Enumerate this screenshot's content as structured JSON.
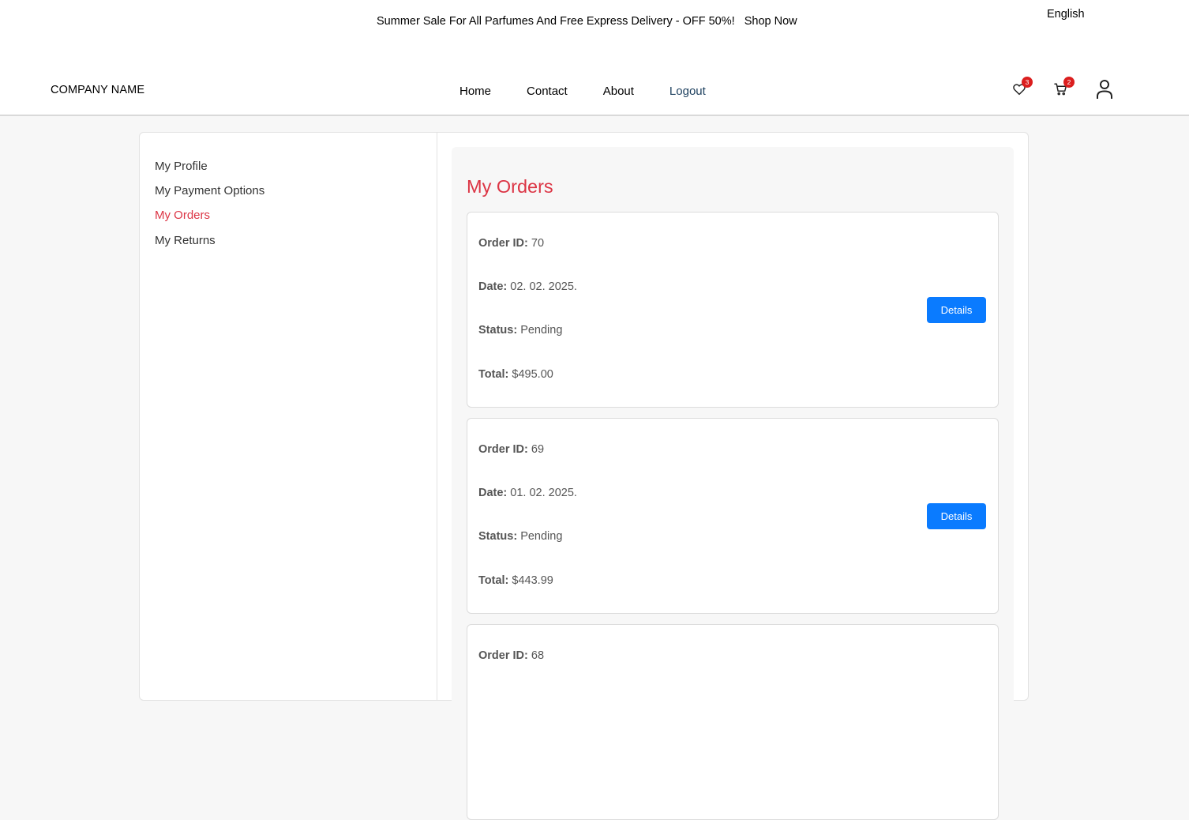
{
  "promo": {
    "text": "Summer Sale For All Parfumes And Free Express Delivery - OFF 50%!",
    "link": "Shop Now"
  },
  "language": "English",
  "brand": "COMPANY NAME",
  "nav": {
    "home": "Home",
    "contact": "Contact",
    "about": "About",
    "logout": "Logout"
  },
  "icons": {
    "wishlist": "heart-icon",
    "cart": "cart-icon",
    "user": "user-icon"
  },
  "badges": {
    "wishlist": "3",
    "cart": "2"
  },
  "sidebar": {
    "items": [
      {
        "label": "My Profile"
      },
      {
        "label": "My Payment Options"
      },
      {
        "label": "My Orders",
        "active": true
      },
      {
        "label": "My Returns"
      }
    ]
  },
  "main": {
    "title": "My Orders"
  },
  "labels": {
    "order_id": "Order ID:",
    "date": "Date:",
    "status": "Status:",
    "total": "Total:",
    "details": "Details"
  },
  "orders": [
    {
      "id": "70",
      "date": "02. 02. 2025.",
      "status": "Pending",
      "total": "$495.00"
    },
    {
      "id": "69",
      "date": "01. 02. 2025.",
      "status": "Pending",
      "total": "$443.99"
    },
    {
      "id": "68"
    }
  ],
  "colors": {
    "accent": "#dc3545",
    "button": "#0a7bff",
    "badge": "#db1e1e"
  }
}
